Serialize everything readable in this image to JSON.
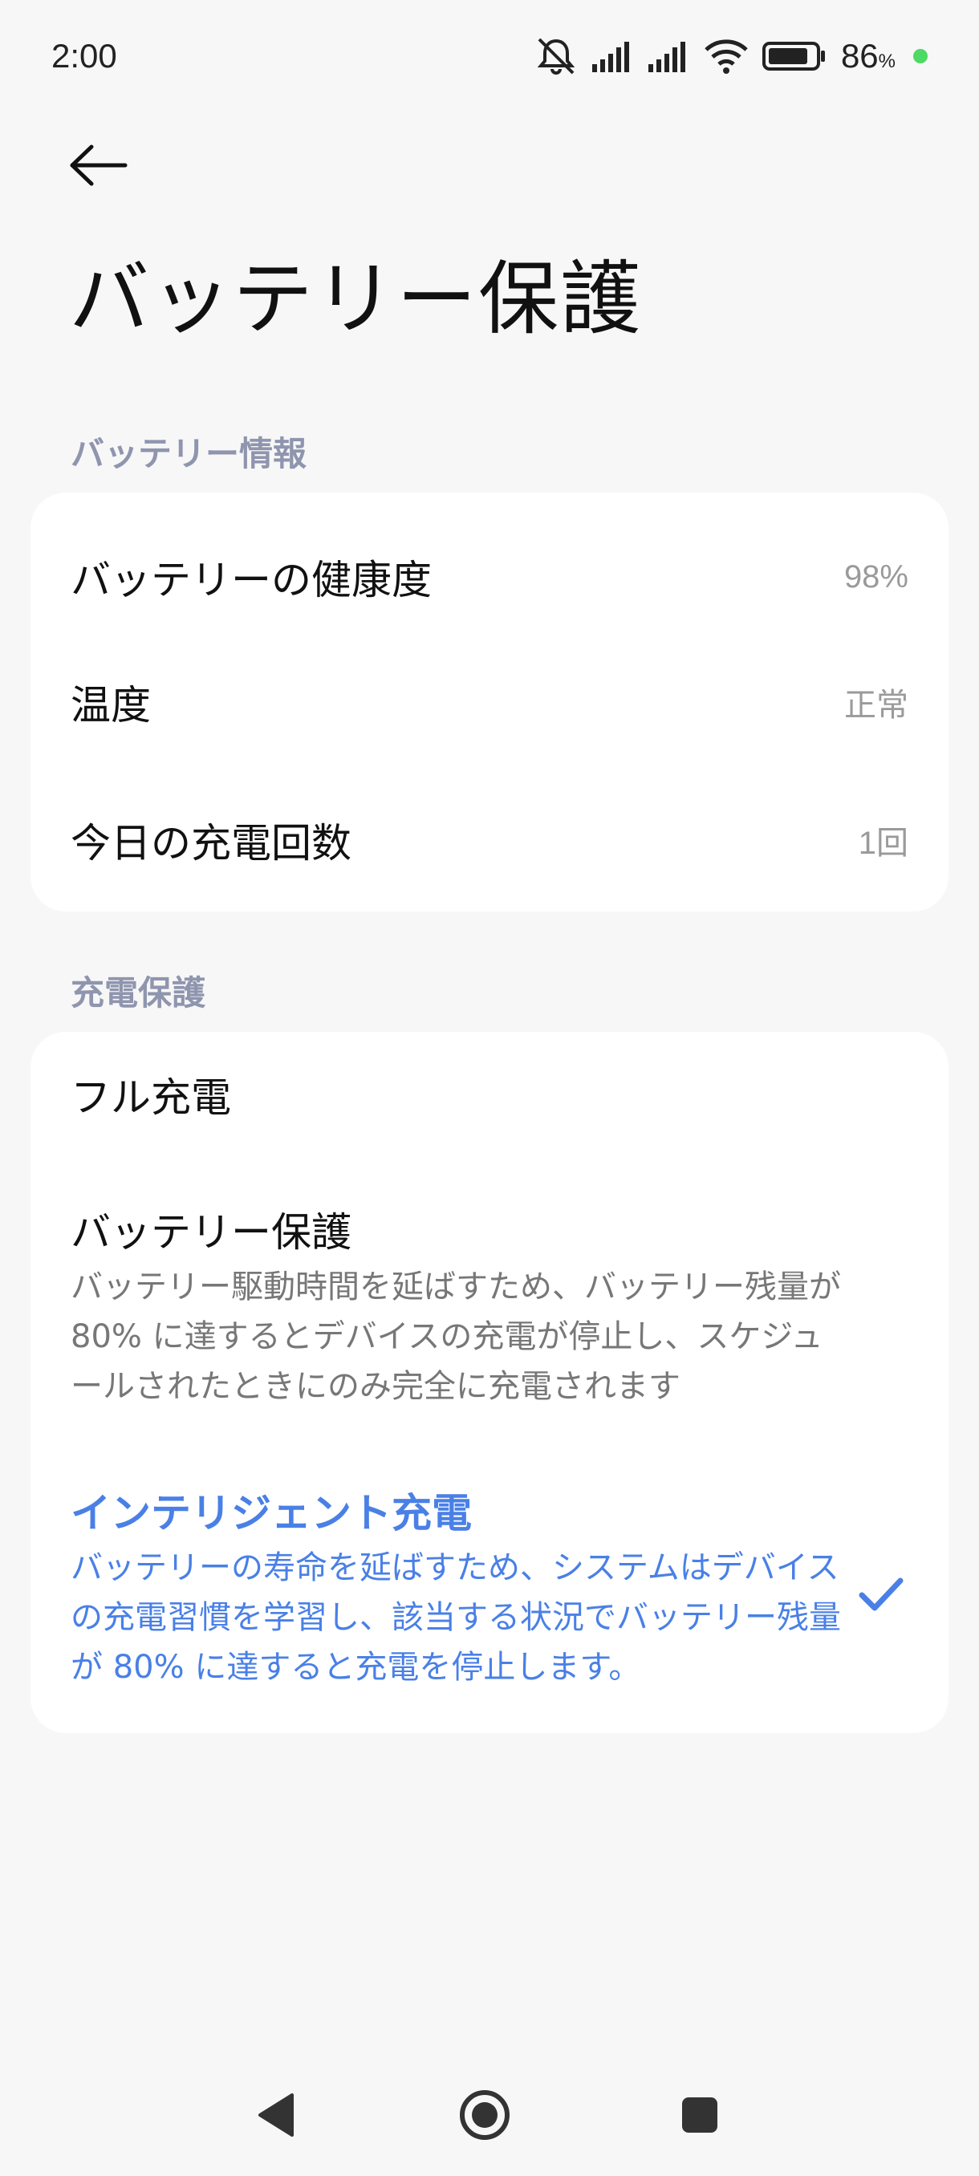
{
  "status_bar": {
    "time": "2:00",
    "battery_percent": "86",
    "battery_percent_unit": "%",
    "battery_level": 0.86,
    "charging_indicator_color": "#4cd964",
    "icons": [
      "mute-icon",
      "signal-icon",
      "signal-icon",
      "wifi-icon",
      "battery-icon"
    ]
  },
  "header": {
    "back_icon": "back-arrow-icon",
    "title": "バッテリー保護"
  },
  "battery_info": {
    "section_label": "バッテリー情報",
    "rows": [
      {
        "label": "バッテリーの健康度",
        "value": "98%"
      },
      {
        "label": "温度",
        "value": "正常"
      },
      {
        "label": "今日の充電回数",
        "value": "1回"
      }
    ]
  },
  "charge_protection": {
    "section_label": "充電保護",
    "options": [
      {
        "title": "フル充電",
        "description": "",
        "selected": false
      },
      {
        "title": "バッテリー保護",
        "description": "バッテリー駆動時間を延ばすため、バッテリー残量が 80% に達するとデバイスの充電が停止し、スケジュールされたときにのみ完全に充電されます",
        "selected": false
      },
      {
        "title": "インテリジェント充電",
        "description": "バッテリーの寿命を延ばすため、システムはデバイスの充電習慣を学習し、該当する状況でバッテリー残量が 80% に達すると充電を停止します。",
        "selected": true
      }
    ]
  },
  "colors": {
    "accent": "#4a80e6",
    "section_label": "#8f95ae",
    "background": "#f7f7f7",
    "card": "#ffffff"
  },
  "nav_bar": {
    "icons": [
      "back-triangle-icon",
      "home-circle-icon",
      "recents-square-icon"
    ]
  }
}
